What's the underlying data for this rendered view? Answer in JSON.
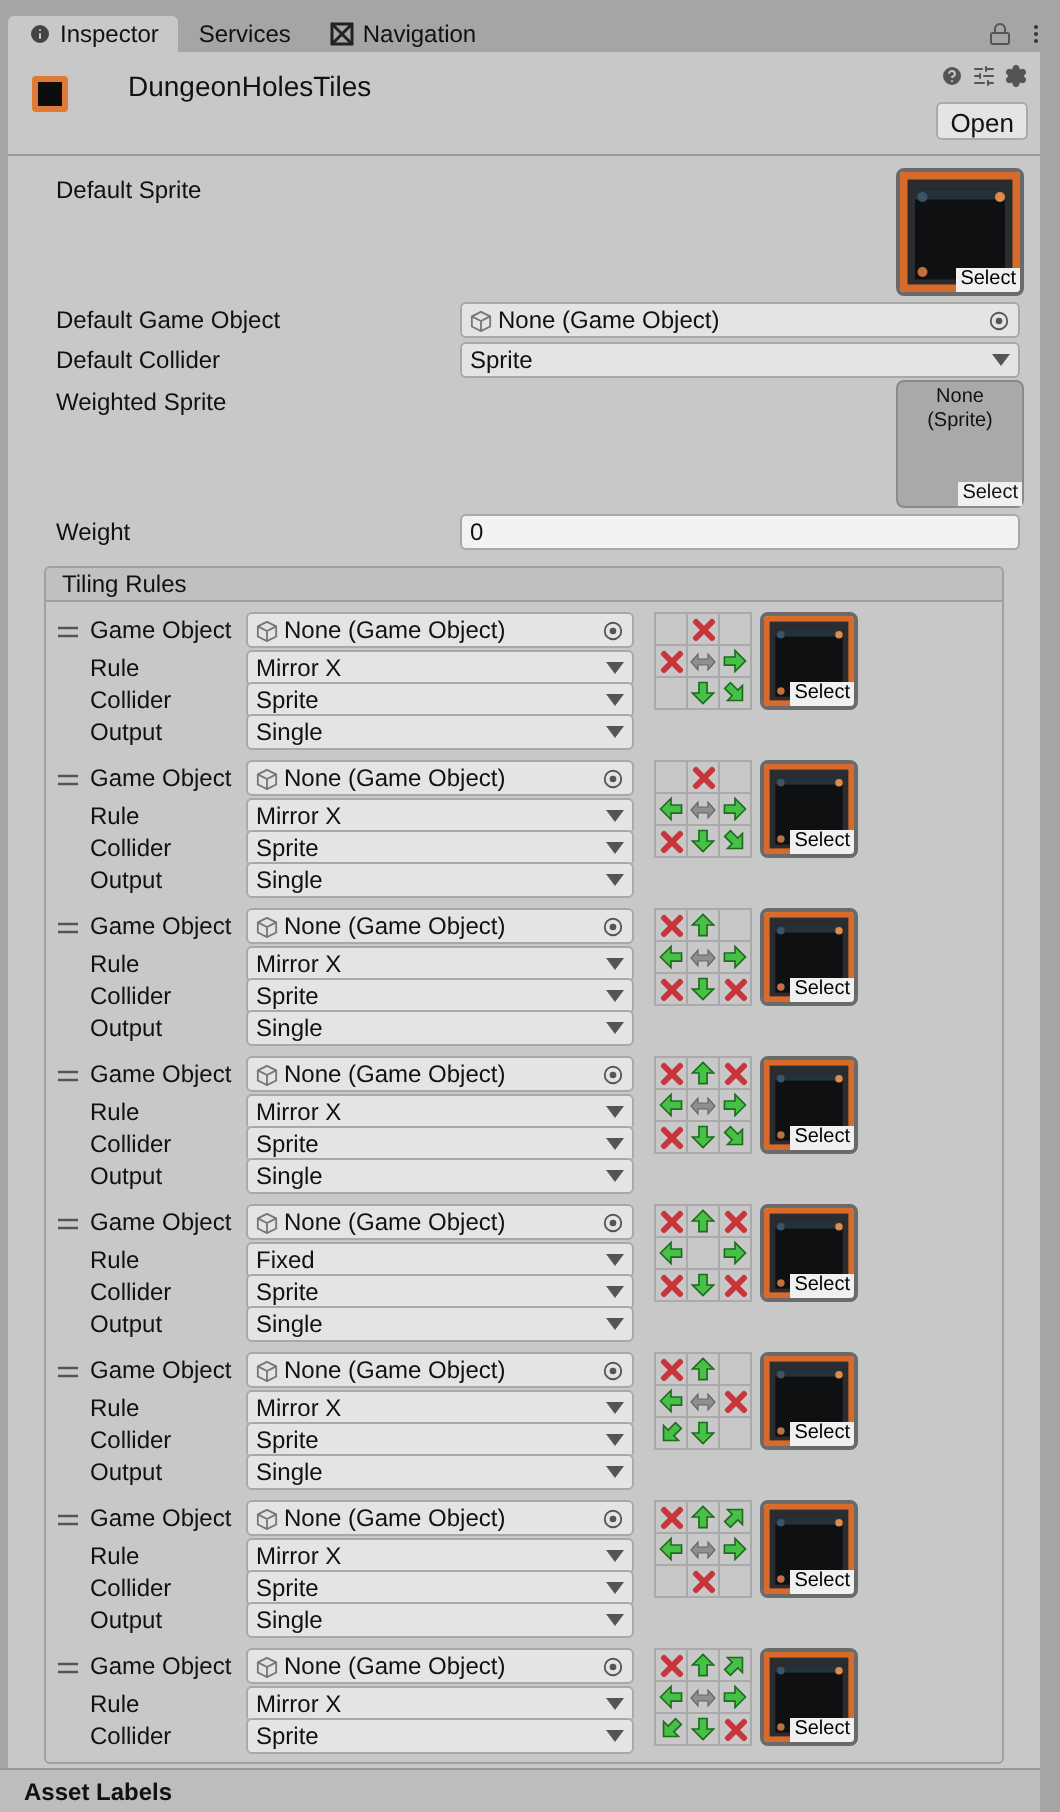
{
  "tabs": [
    {
      "label": "Inspector",
      "selected": true
    },
    {
      "label": "Services",
      "selected": false
    },
    {
      "label": "Navigation",
      "selected": false
    }
  ],
  "asset": {
    "name": "DungeonHolesTiles",
    "open_button": "Open"
  },
  "fields": [
    {
      "kind": "sprite",
      "label": "Default Sprite",
      "select": "Select"
    },
    {
      "kind": "object",
      "label": "Default Game Object",
      "value": "None (Game Object)"
    },
    {
      "kind": "dropdown",
      "label": "Default Collider",
      "value": "Sprite"
    },
    {
      "kind": "empty_sprite",
      "label": "Weighted Sprite",
      "value": "None (Sprite)",
      "select": "Select"
    },
    {
      "kind": "text",
      "label": "Weight",
      "value": "0"
    }
  ],
  "tiling_rules": {
    "title": "Tiling Rules",
    "rules": [
      {
        "fields": [
          {
            "kind": "object",
            "label": "Game Object",
            "value": "None (Game Object)"
          },
          {
            "kind": "dropdown",
            "label": "Rule",
            "value": "Mirror X"
          },
          {
            "kind": "dropdown",
            "label": "Collider",
            "value": "Sprite"
          },
          {
            "kind": "dropdown",
            "label": "Output",
            "value": "Single"
          }
        ],
        "neighbors": [
          {
            "kind": "blank"
          },
          {
            "kind": "cross"
          },
          {
            "kind": "blank"
          },
          {
            "kind": "cross"
          },
          {
            "kind": "mirror"
          },
          {
            "kind": "east"
          },
          {
            "kind": "blank"
          },
          {
            "kind": "south"
          },
          {
            "kind": "southeast"
          }
        ],
        "select": "Select"
      },
      {
        "fields": [
          {
            "kind": "object",
            "label": "Game Object",
            "value": "None (Game Object)"
          },
          {
            "kind": "dropdown",
            "label": "Rule",
            "value": "Mirror X"
          },
          {
            "kind": "dropdown",
            "label": "Collider",
            "value": "Sprite"
          },
          {
            "kind": "dropdown",
            "label": "Output",
            "value": "Single"
          }
        ],
        "neighbors": [
          {
            "kind": "blank"
          },
          {
            "kind": "cross"
          },
          {
            "kind": "blank"
          },
          {
            "kind": "west"
          },
          {
            "kind": "mirror"
          },
          {
            "kind": "east"
          },
          {
            "kind": "cross"
          },
          {
            "kind": "south"
          },
          {
            "kind": "southeast"
          }
        ],
        "select": "Select"
      },
      {
        "fields": [
          {
            "kind": "object",
            "label": "Game Object",
            "value": "None (Game Object)"
          },
          {
            "kind": "dropdown",
            "label": "Rule",
            "value": "Mirror X"
          },
          {
            "kind": "dropdown",
            "label": "Collider",
            "value": "Sprite"
          },
          {
            "kind": "dropdown",
            "label": "Output",
            "value": "Single"
          }
        ],
        "neighbors": [
          {
            "kind": "cross"
          },
          {
            "kind": "north"
          },
          {
            "kind": "blank"
          },
          {
            "kind": "west"
          },
          {
            "kind": "mirror"
          },
          {
            "kind": "east"
          },
          {
            "kind": "cross"
          },
          {
            "kind": "south"
          },
          {
            "kind": "cross"
          }
        ],
        "select": "Select"
      },
      {
        "fields": [
          {
            "kind": "object",
            "label": "Game Object",
            "value": "None (Game Object)"
          },
          {
            "kind": "dropdown",
            "label": "Rule",
            "value": "Mirror X"
          },
          {
            "kind": "dropdown",
            "label": "Collider",
            "value": "Sprite"
          },
          {
            "kind": "dropdown",
            "label": "Output",
            "value": "Single"
          }
        ],
        "neighbors": [
          {
            "kind": "cross"
          },
          {
            "kind": "north"
          },
          {
            "kind": "cross"
          },
          {
            "kind": "west"
          },
          {
            "kind": "mirror"
          },
          {
            "kind": "east"
          },
          {
            "kind": "cross"
          },
          {
            "kind": "south"
          },
          {
            "kind": "southeast"
          }
        ],
        "select": "Select"
      },
      {
        "fields": [
          {
            "kind": "object",
            "label": "Game Object",
            "value": "None (Game Object)"
          },
          {
            "kind": "dropdown",
            "label": "Rule",
            "value": "Fixed"
          },
          {
            "kind": "dropdown",
            "label": "Collider",
            "value": "Sprite"
          },
          {
            "kind": "dropdown",
            "label": "Output",
            "value": "Single"
          }
        ],
        "neighbors": [
          {
            "kind": "cross"
          },
          {
            "kind": "north"
          },
          {
            "kind": "cross"
          },
          {
            "kind": "west"
          },
          {
            "kind": "blank"
          },
          {
            "kind": "east"
          },
          {
            "kind": "cross"
          },
          {
            "kind": "south"
          },
          {
            "kind": "cross"
          }
        ],
        "select": "Select"
      },
      {
        "fields": [
          {
            "kind": "object",
            "label": "Game Object",
            "value": "None (Game Object)"
          },
          {
            "kind": "dropdown",
            "label": "Rule",
            "value": "Mirror X"
          },
          {
            "kind": "dropdown",
            "label": "Collider",
            "value": "Sprite"
          },
          {
            "kind": "dropdown",
            "label": "Output",
            "value": "Single"
          }
        ],
        "neighbors": [
          {
            "kind": "cross"
          },
          {
            "kind": "north"
          },
          {
            "kind": "blank"
          },
          {
            "kind": "west"
          },
          {
            "kind": "mirror"
          },
          {
            "kind": "cross"
          },
          {
            "kind": "southwest"
          },
          {
            "kind": "south"
          },
          {
            "kind": "blank"
          }
        ],
        "select": "Select"
      },
      {
        "fields": [
          {
            "kind": "object",
            "label": "Game Object",
            "value": "None (Game Object)"
          },
          {
            "kind": "dropdown",
            "label": "Rule",
            "value": "Mirror X"
          },
          {
            "kind": "dropdown",
            "label": "Collider",
            "value": "Sprite"
          },
          {
            "kind": "dropdown",
            "label": "Output",
            "value": "Single"
          }
        ],
        "neighbors": [
          {
            "kind": "cross"
          },
          {
            "kind": "north"
          },
          {
            "kind": "northeast"
          },
          {
            "kind": "west"
          },
          {
            "kind": "mirror"
          },
          {
            "kind": "east"
          },
          {
            "kind": "blank"
          },
          {
            "kind": "cross"
          },
          {
            "kind": "blank"
          }
        ],
        "select": "Select"
      },
      {
        "fields": [
          {
            "kind": "object",
            "label": "Game Object",
            "value": "None (Game Object)"
          },
          {
            "kind": "dropdown",
            "label": "Rule",
            "value": "Mirror X"
          },
          {
            "kind": "dropdown",
            "label": "Collider",
            "value": "Sprite"
          }
        ],
        "neighbors": [
          {
            "kind": "cross"
          },
          {
            "kind": "north"
          },
          {
            "kind": "northeast"
          },
          {
            "kind": "west"
          },
          {
            "kind": "mirror"
          },
          {
            "kind": "east"
          },
          {
            "kind": "southwest"
          },
          {
            "kind": "south"
          },
          {
            "kind": "cross"
          }
        ],
        "select": "Select"
      }
    ]
  },
  "asset_labels": "Asset Labels"
}
